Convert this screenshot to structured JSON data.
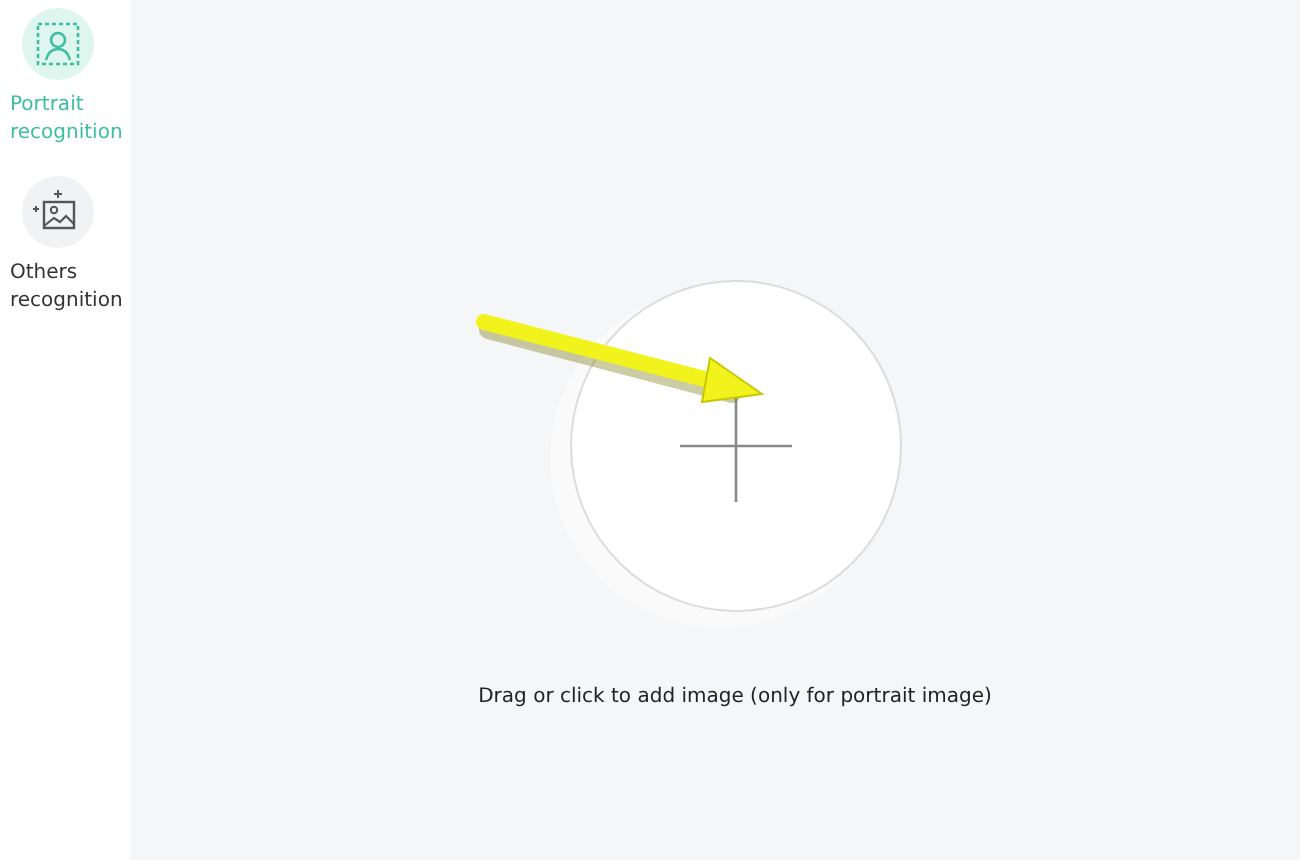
{
  "sidebar": {
    "items": [
      {
        "kind": "portrait",
        "label": "Portrait recognition",
        "selected": true
      },
      {
        "kind": "others",
        "label": "Others recognition",
        "selected": false
      }
    ]
  },
  "upload": {
    "hint": "Drag or click to add image (only for portrait image)"
  }
}
